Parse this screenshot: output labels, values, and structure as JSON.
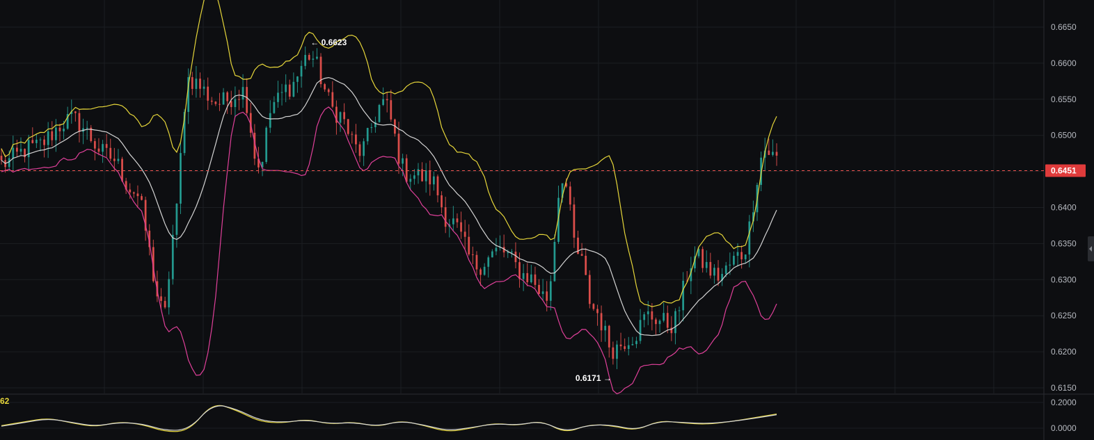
{
  "chart_data": [
    {
      "type": "candlestick",
      "overlays": [
        "bollinger-upper",
        "bollinger-middle",
        "bollinger-lower"
      ],
      "y_ticks": [
        "0.6650",
        "0.6600",
        "0.6550",
        "0.6500",
        "0.6400",
        "0.6350",
        "0.6300",
        "0.6250",
        "0.6200",
        "0.6150"
      ],
      "ylim": [
        0.614,
        0.6665
      ],
      "current_price": 0.6451,
      "current_price_label": "0.6451",
      "annotations": [
        {
          "label": "← 0.6623",
          "value": 0.6623,
          "index": 79
        },
        {
          "label": "0.6171 →",
          "value": 0.6171,
          "index": 157
        }
      ],
      "colors": {
        "up": "#26a69a",
        "down": "#ef5350",
        "upper_band": "#e6d63a",
        "middle_band": "#d4d4d4",
        "lower_band": "#e0409a",
        "price_line": "#ef5350",
        "grid": "#1c1e22"
      },
      "grid": true,
      "candle_count": 200,
      "path_anchors": [
        [
          0,
          0.6461
        ],
        [
          8,
          0.6483
        ],
        [
          18,
          0.6522
        ],
        [
          28,
          0.647
        ],
        [
          34,
          0.6423
        ],
        [
          42,
          0.6252
        ],
        [
          44,
          0.6361
        ],
        [
          48,
          0.6578
        ],
        [
          56,
          0.6545
        ],
        [
          62,
          0.6562
        ],
        [
          66,
          0.6458
        ],
        [
          70,
          0.6545
        ],
        [
          74,
          0.6568
        ],
        [
          79,
          0.6611
        ],
        [
          86,
          0.6532
        ],
        [
          92,
          0.6478
        ],
        [
          98,
          0.6545
        ],
        [
          104,
          0.6448
        ],
        [
          110,
          0.644
        ],
        [
          115,
          0.6382
        ],
        [
          122,
          0.632
        ],
        [
          128,
          0.634
        ],
        [
          135,
          0.6305
        ],
        [
          140,
          0.6275
        ],
        [
          144,
          0.6445
        ],
        [
          148,
          0.6335
        ],
        [
          152,
          0.626
        ],
        [
          157,
          0.6205
        ],
        [
          162,
          0.6222
        ],
        [
          166,
          0.625
        ],
        [
          172,
          0.6238
        ],
        [
          178,
          0.633
        ],
        [
          184,
          0.6305
        ],
        [
          190,
          0.6335
        ],
        [
          196,
          0.648
        ],
        [
          199,
          0.6468
        ]
      ]
    },
    {
      "type": "line",
      "label": "62",
      "y_ticks": [
        "0.2000",
        "0.0000"
      ],
      "ylim": [
        -0.045,
        0.23
      ],
      "series": [
        {
          "color": "#e6d63a",
          "values": [
            0.02,
            0.05,
            0.08,
            0.04,
            0.01,
            0.05,
            0.03,
            -0.03,
            -0.02,
            0.2,
            0.14,
            0.05,
            0.04,
            0.07,
            0.03,
            0.05,
            0.01,
            0.06,
            0.02,
            -0.03,
            0.0,
            0.04,
            0.02,
            0.06,
            -0.04,
            0.03,
            0.02,
            -0.02,
            0.06,
            0.04,
            0.03,
            0.05,
            0.08,
            0.11
          ]
        },
        {
          "color": "#d4d4d4",
          "values": [
            0.015,
            0.045,
            0.075,
            0.045,
            0.015,
            0.045,
            0.035,
            -0.02,
            -0.01,
            0.19,
            0.15,
            0.06,
            0.045,
            0.065,
            0.035,
            0.045,
            0.015,
            0.055,
            0.025,
            -0.02,
            0.005,
            0.035,
            0.025,
            0.055,
            -0.03,
            0.025,
            0.025,
            -0.015,
            0.055,
            0.045,
            0.035,
            0.05,
            0.075,
            0.105
          ]
        }
      ]
    }
  ]
}
